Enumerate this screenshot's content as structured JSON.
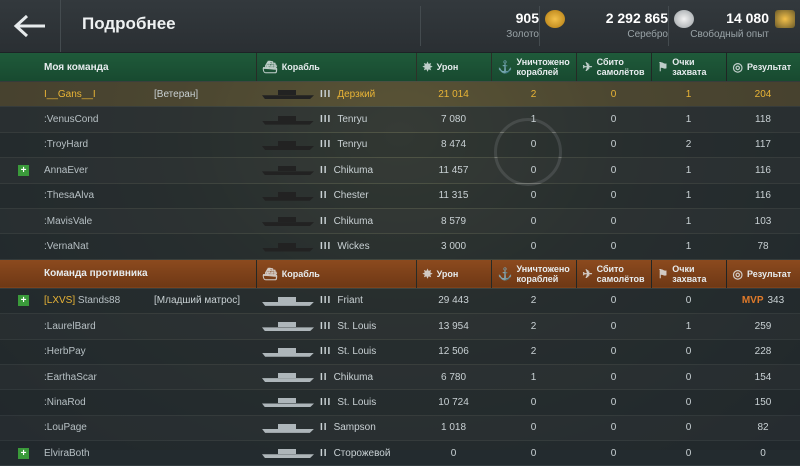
{
  "header": {
    "title": "Подробнее",
    "gold": {
      "value": "905",
      "label": "Золото"
    },
    "silver": {
      "value": "2 292 865",
      "label": "Серебро"
    },
    "xp": {
      "value": "14 080",
      "label": "Свободный опыт"
    }
  },
  "columns": {
    "ship": "Корабль",
    "damage": "Урон",
    "destroyed": [
      "Уничтожено",
      "кораблей"
    ],
    "planes": [
      "Сбито",
      "самолётов"
    ],
    "capture": [
      "Очки",
      "захвата"
    ],
    "result": "Результат"
  },
  "my_team": {
    "title": "Моя команда",
    "rows": [
      {
        "add": false,
        "clan": "",
        "name": "I__Gans__I",
        "rank": "[Ветеран]",
        "tier": "III",
        "ship": "Дерзкий",
        "damage": "21 014",
        "kills": "2",
        "planes": "0",
        "cap": "1",
        "result": "204",
        "me": true
      },
      {
        "add": false,
        "clan": "",
        "name": ":VenusCond",
        "rank": "",
        "tier": "III",
        "ship": "Tenryu",
        "damage": "7 080",
        "kills": "1",
        "planes": "0",
        "cap": "1",
        "result": "118"
      },
      {
        "add": false,
        "clan": "",
        "name": ":TroyHard",
        "rank": "",
        "tier": "III",
        "ship": "Tenryu",
        "damage": "8 474",
        "kills": "0",
        "planes": "0",
        "cap": "2",
        "result": "117"
      },
      {
        "add": true,
        "clan": "",
        "name": "AnnaEver",
        "rank": "",
        "tier": "II",
        "ship": "Chikuma",
        "damage": "11 457",
        "kills": "0",
        "planes": "0",
        "cap": "1",
        "result": "116"
      },
      {
        "add": false,
        "clan": "",
        "name": ":ThesaAlva",
        "rank": "",
        "tier": "II",
        "ship": "Chester",
        "damage": "11 315",
        "kills": "0",
        "planes": "0",
        "cap": "1",
        "result": "116"
      },
      {
        "add": false,
        "clan": "",
        "name": ":MavisVale",
        "rank": "",
        "tier": "II",
        "ship": "Chikuma",
        "damage": "8 579",
        "kills": "0",
        "planes": "0",
        "cap": "1",
        "result": "103"
      },
      {
        "add": false,
        "clan": "",
        "name": ":VernaNat",
        "rank": "",
        "tier": "III",
        "ship": "Wickes",
        "damage": "3 000",
        "kills": "0",
        "planes": "0",
        "cap": "1",
        "result": "78"
      }
    ]
  },
  "enemy_team": {
    "title": "Команда противника",
    "rows": [
      {
        "add": true,
        "clan": "[LXVS]",
        "name": "Stands88",
        "rank": "[Младший матрос]",
        "tier": "III",
        "ship": "Friant",
        "damage": "29 443",
        "kills": "2",
        "planes": "0",
        "cap": "0",
        "result": "343",
        "mvp": "MVP"
      },
      {
        "add": false,
        "clan": "",
        "name": ":LaurelBard",
        "rank": "",
        "tier": "III",
        "ship": "St. Louis",
        "damage": "13 954",
        "kills": "2",
        "planes": "0",
        "cap": "1",
        "result": "259"
      },
      {
        "add": false,
        "clan": "",
        "name": ":HerbPay",
        "rank": "",
        "tier": "III",
        "ship": "St. Louis",
        "damage": "12 506",
        "kills": "2",
        "planes": "0",
        "cap": "0",
        "result": "228"
      },
      {
        "add": false,
        "clan": "",
        "name": ":EarthaScar",
        "rank": "",
        "tier": "II",
        "ship": "Chikuma",
        "damage": "6 780",
        "kills": "1",
        "planes": "0",
        "cap": "0",
        "result": "154"
      },
      {
        "add": false,
        "clan": "",
        "name": ":NinaRod",
        "rank": "",
        "tier": "III",
        "ship": "St. Louis",
        "damage": "10 724",
        "kills": "0",
        "planes": "0",
        "cap": "0",
        "result": "150"
      },
      {
        "add": false,
        "clan": "",
        "name": ":LouPage",
        "rank": "",
        "tier": "II",
        "ship": "Sampson",
        "damage": "1 018",
        "kills": "0",
        "planes": "0",
        "cap": "0",
        "result": "82"
      },
      {
        "add": true,
        "clan": "",
        "name": "ElviraBoth",
        "rank": "",
        "tier": "II",
        "ship": "Сторожевой",
        "damage": "0",
        "kills": "0",
        "planes": "0",
        "cap": "0",
        "result": "0"
      }
    ]
  }
}
